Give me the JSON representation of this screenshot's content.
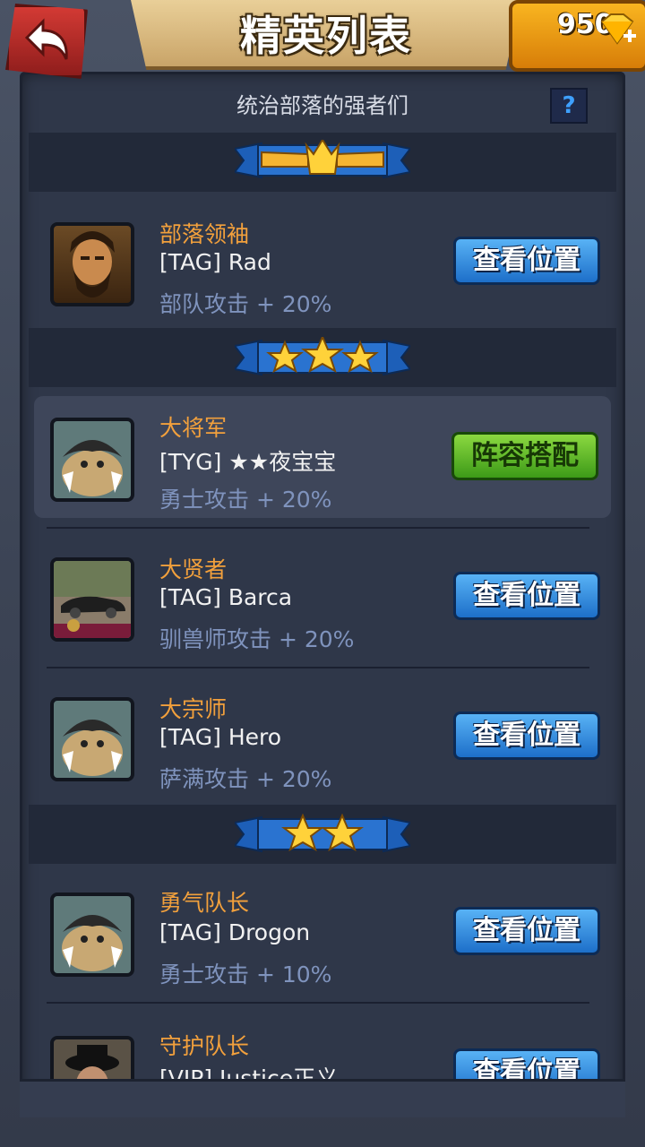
{
  "header": {
    "title": "精英列表",
    "gems": "950",
    "subtitle": "统治部落的强者们",
    "help_label": "?"
  },
  "rows": [
    {
      "rank": "部落领袖",
      "name": "[TAG] Rad",
      "bonus": "部队攻击 + 20%",
      "button": "查看位置",
      "avatar": "bearded-warrior-avatar"
    },
    {
      "rank": "大将军",
      "name": "[TYG] ★★夜宝宝",
      "bonus": "勇士攻击 + 20%",
      "button": "阵容搭配",
      "avatar": "default-beast-avatar"
    },
    {
      "rank": "大贤者",
      "name": "[TAG] Barca",
      "bonus": "驯兽师攻击 + 20%",
      "button": "查看位置",
      "avatar": "car-photo-avatar"
    },
    {
      "rank": "大宗师",
      "name": "[TAG] Hero",
      "bonus": "萨满攻击 + 20%",
      "button": "查看位置",
      "avatar": "default-beast-avatar"
    },
    {
      "rank": "勇气队长",
      "name": "[TAG] Drogon",
      "bonus": "勇士攻击 + 10%",
      "button": "查看位置",
      "avatar": "default-beast-avatar"
    },
    {
      "rank": "守护队长",
      "name": "[VIP] Justice正义",
      "bonus": "",
      "button": "查看位置",
      "avatar": "hat-photo-avatar"
    }
  ],
  "tiers": [
    {
      "stars": 0,
      "emblem": "crown-wings-icon"
    },
    {
      "stars": 3
    },
    {
      "stars": 2
    }
  ],
  "colors": {
    "rank": "#f2a03c",
    "bonus": "#7f93bd",
    "blue_button": "#2c85dd",
    "green_button": "#5cb82a"
  }
}
